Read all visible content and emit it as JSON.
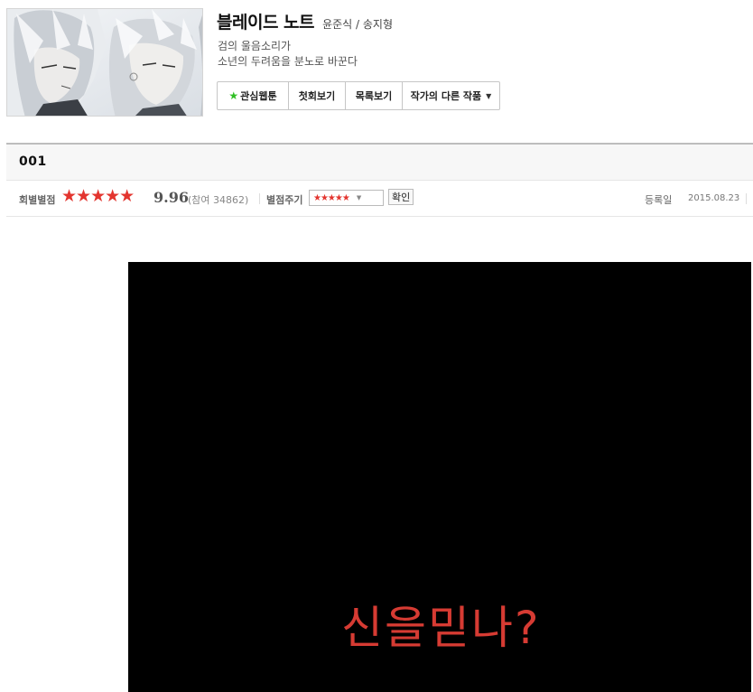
{
  "header": {
    "title": "블레이드 노트",
    "author": "윤준식 / 송지형",
    "description": [
      "검의 울음소리가",
      "소년의 두려움을 분노로 바꾼다"
    ]
  },
  "buttons": {
    "favorite": "관심웹툰",
    "first": "첫회보기",
    "list": "목록보기",
    "other_works": "작가의 다른 작품"
  },
  "episode": {
    "title": "001",
    "rating_label": "회별별점",
    "stars": "★★★★★",
    "score": "9.96",
    "participants": "(참여 34862)",
    "give_rating_label": "별점주기",
    "select_stars": "★★★★★",
    "confirm": "확인",
    "registered_label": "등록일",
    "registered_date": "2015.08.23"
  },
  "comic": {
    "text": "신을믿나?"
  },
  "colors": {
    "star_red": "#e3352f",
    "favorite_green": "#2fbf23",
    "comic_text": "#d63b33"
  },
  "icons": [
    "favorite-star-icon",
    "dropdown-caret-icon"
  ]
}
